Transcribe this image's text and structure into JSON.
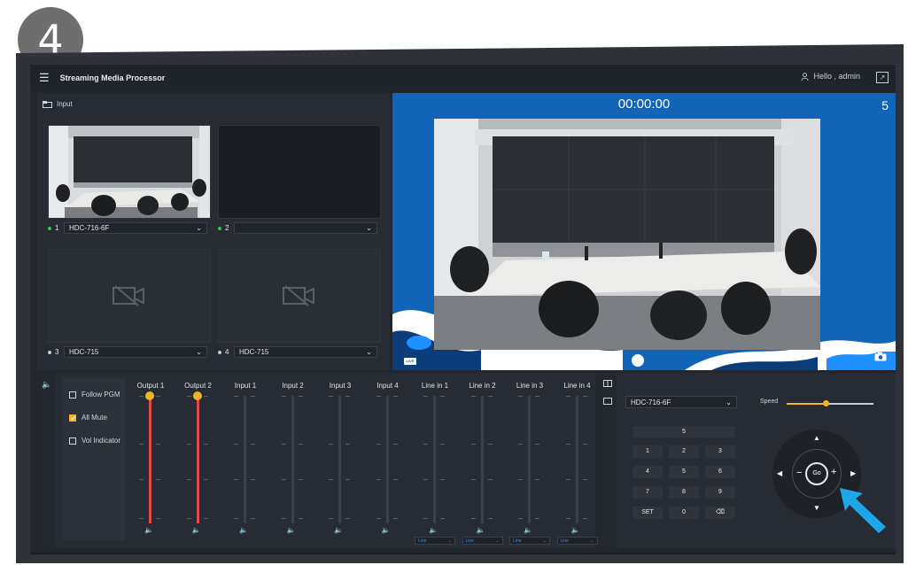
{
  "step_badge": "4",
  "topbar": {
    "menu_icon": "menu-icon",
    "title": "Streaming Media Processor",
    "greeting": "Hello , admin",
    "expand_icon": "expand-icon"
  },
  "input_panel": {
    "header": "Input",
    "channels": [
      {
        "num": "1",
        "source": "HDC-716-6F",
        "status_color": "#2ecc40"
      },
      {
        "num": "2",
        "source": "",
        "status_color": "#2ecc40"
      },
      {
        "num": "3",
        "source": "HDC-715",
        "status_color": "#c9ced6"
      },
      {
        "num": "4",
        "source": "HDC-715",
        "status_color": "#c9ced6"
      }
    ]
  },
  "preview": {
    "timer": "00:00:00",
    "count": "5",
    "live_label": "LIVE"
  },
  "audio": {
    "options": [
      {
        "label": "Follow PGM",
        "checked": false
      },
      {
        "label": "All Mute",
        "checked": true
      },
      {
        "label": "Vol Indicator",
        "checked": false
      }
    ],
    "channels": [
      {
        "label": "Output 1",
        "level": 1.0,
        "mini": ""
      },
      {
        "label": "Output 2",
        "level": 1.0,
        "mini": ""
      },
      {
        "label": "Input 1",
        "level": 0,
        "mini": ""
      },
      {
        "label": "Input 2",
        "level": 0,
        "mini": ""
      },
      {
        "label": "Input 3",
        "level": 0,
        "mini": ""
      },
      {
        "label": "Input 4",
        "level": 0,
        "mini": ""
      },
      {
        "label": "Line in 1",
        "level": 0,
        "mini": "Line"
      },
      {
        "label": "Line in 2",
        "level": 0,
        "mini": "Line"
      },
      {
        "label": "Line in 3",
        "level": 0,
        "mini": "Line"
      },
      {
        "label": "Line in 4",
        "level": 0,
        "mini": "Line"
      }
    ]
  },
  "ptz": {
    "camera": "HDC-716-6F",
    "speed_label": "Speed",
    "speed_level": 0.45,
    "preset_display": "5",
    "keys": [
      "1",
      "2",
      "3",
      "4",
      "5",
      "6",
      "7",
      "8",
      "9",
      "SET",
      "0",
      "⌫"
    ],
    "go_label": "Go"
  },
  "colors": {
    "accent": "#f0b429",
    "preview_bg": "#1264b8",
    "arrow": "#1ea7e8"
  }
}
